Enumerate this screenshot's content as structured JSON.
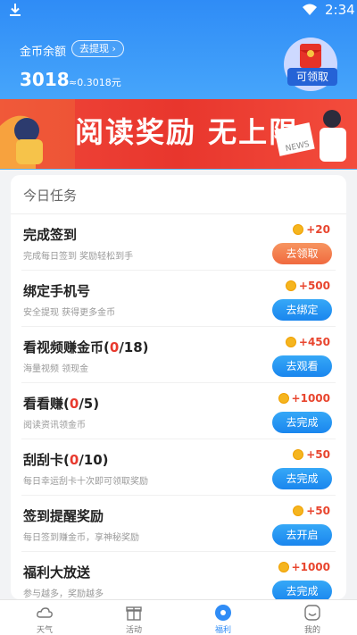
{
  "status_bar": {
    "time": "2:34"
  },
  "wallet": {
    "label": "金币余额",
    "withdraw_label": "去提现",
    "coins": "3018",
    "rmb_value": "≈0.3018元",
    "claim_label": "可领取"
  },
  "banner": {
    "text": "阅读奖励 无上限"
  },
  "tasks_section": {
    "title": "今日任务",
    "items": [
      {
        "title": "完成签到",
        "count": "",
        "description": "完成每日签到 奖励轻松到手",
        "reward": "+20",
        "button": "去领取",
        "button_style": "orange"
      },
      {
        "title": "绑定手机号",
        "count": "",
        "description": "安全提现 获得更多金币",
        "reward": "+500",
        "button": "去绑定",
        "button_style": "blue"
      },
      {
        "title": "看视频赚金币",
        "count": "0",
        "count_total": "/18)",
        "description": "海量视频 领现金",
        "reward": "+450",
        "button": "去观看",
        "button_style": "blue"
      },
      {
        "title": "看看赚",
        "count": "0",
        "count_total": "/5)",
        "description": "阅读资讯领金币",
        "reward": "+1000",
        "button": "去完成",
        "button_style": "blue"
      },
      {
        "title": "刮刮卡",
        "count": "0",
        "count_total": "/10)",
        "description": "每日幸运刮卡十次即可领取奖励",
        "reward": "+50",
        "button": "去完成",
        "button_style": "blue"
      },
      {
        "title": "签到提醒奖励",
        "count": "",
        "description": "每日签到赚金币，享神秘奖励",
        "reward": "+50",
        "button": "去开启",
        "button_style": "blue"
      },
      {
        "title": "福利大放送",
        "count": "",
        "description": "参与越多，奖励越多",
        "reward": "+1000",
        "button": "去完成",
        "button_style": "blue"
      }
    ]
  },
  "tabbar": {
    "items": [
      {
        "label": "天气",
        "icon": "weather-icon"
      },
      {
        "label": "活动",
        "icon": "gift-box-icon"
      },
      {
        "label": "福利",
        "icon": "welfare-coin-icon",
        "active": true
      },
      {
        "label": "我的",
        "icon": "profile-icon"
      }
    ]
  },
  "colors": {
    "primary": "#2f8cf6",
    "accent_red": "#e83a2e",
    "button_orange": "#f06a3f",
    "banner_red": "#e8362d"
  }
}
